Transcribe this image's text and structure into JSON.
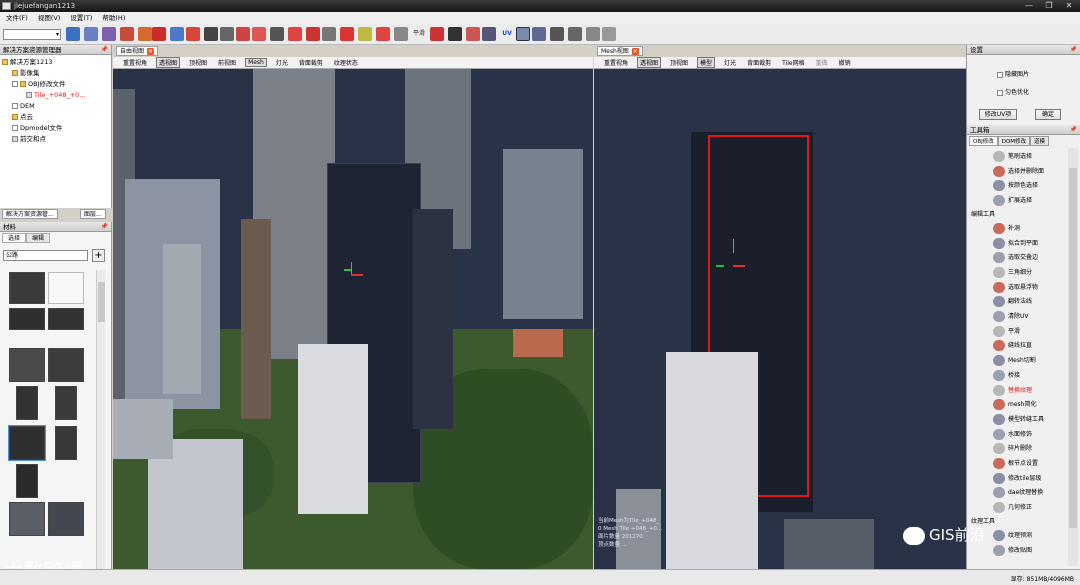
{
  "window": {
    "title": "jiejuefangan1213",
    "controls": [
      "—",
      "❐",
      "✕"
    ]
  },
  "menu": [
    "文件(F)",
    "视图(V)",
    "设置(T)",
    "帮助(H)"
  ],
  "toolbar": {
    "combo_value": "",
    "uv_label": "UV",
    "flat_label": "平滑"
  },
  "left_panel": {
    "title": "解决方案资源管理器",
    "tree": [
      {
        "label": "解决方案1213",
        "level": 0,
        "checked": false
      },
      {
        "label": "影像集",
        "level": 1,
        "checked": false
      },
      {
        "label": "OBJ修改文件",
        "level": 1,
        "checked": false
      },
      {
        "label": "Tile_+048_+0...",
        "level": 2,
        "checked": true,
        "highlight": true
      },
      {
        "label": "DEM",
        "level": 1,
        "checked": false
      },
      {
        "label": "点云",
        "level": 1,
        "checked": false
      },
      {
        "label": "Dpmodel文件",
        "level": 1,
        "checked": false
      },
      {
        "label": "前交和点",
        "level": 1,
        "checked": true
      }
    ],
    "bottom_tabs": [
      "解决方案资源管...",
      "图层..."
    ]
  },
  "materials": {
    "title": "材料",
    "tabs": [
      "选择",
      "编辑"
    ],
    "select_value": "公路",
    "add_label": "+"
  },
  "left_view": {
    "tab": "自由视图",
    "buttons": [
      "重置视角",
      "透视图",
      "顶视图",
      "前视图",
      "Mesh",
      "灯光",
      "背面裁剪",
      "纹理状态"
    ],
    "active": [
      "透视图",
      "Mesh"
    ]
  },
  "right_view": {
    "tab": "Mesh视图",
    "buttons": [
      "重置视角",
      "透视图",
      "顶视图",
      "模型",
      "灯光",
      "背面裁剪",
      "Tile网格",
      "重做",
      "撤销"
    ],
    "active": [
      "透视图",
      "模型"
    ],
    "overlay": [
      "当前Mesh为Tile_+048_",
      "0 Mesh Tile +048_+0...",
      "面片数量 201270",
      "顶点数量 ..."
    ]
  },
  "settings_panel": {
    "title": "设置",
    "options": [
      {
        "label": "隐藏图片",
        "checked": false
      },
      {
        "label": "匀色优化",
        "checked": false
      }
    ],
    "buttons": [
      "修改UV项",
      "确定"
    ]
  },
  "toolbox": {
    "title": "工具箱",
    "tabs": [
      "OBJ修改",
      "DOM修改",
      "道模"
    ],
    "groups": [
      {
        "name": "",
        "tools": [
          "笔刷选择",
          "选择并删除面",
          "按颜色选择",
          "扩展选择"
        ]
      },
      {
        "name": "编辑工具",
        "tools": [
          "补洞",
          "拟合到平面",
          "选取交叠边",
          "三角细分",
          "选取悬浮物",
          "翻转法线",
          "清除UV",
          "平滑",
          "缝线拉直",
          "Mesh切割",
          "桥接",
          "替换纹理",
          "mesh简化",
          "模型转缝工具",
          "水面修饰",
          "碎片删除",
          "根节点设置",
          "修改tile层级",
          "dae纹理替换",
          "几何修正"
        ]
      },
      {
        "name": "纹理工具",
        "tools": [
          "纹理预测",
          "修改贴图"
        ]
      }
    ],
    "highlight_tool": "替换纹理"
  },
  "status": {
    "memory": "显存: 851MB/4096MB"
  },
  "watermarks": {
    "left": "大数跨境",
    "right": "GIS前沿"
  },
  "colors": {
    "selection_red": "#e01818",
    "sky": "#2a3247",
    "panel": "#f0f0f0"
  }
}
